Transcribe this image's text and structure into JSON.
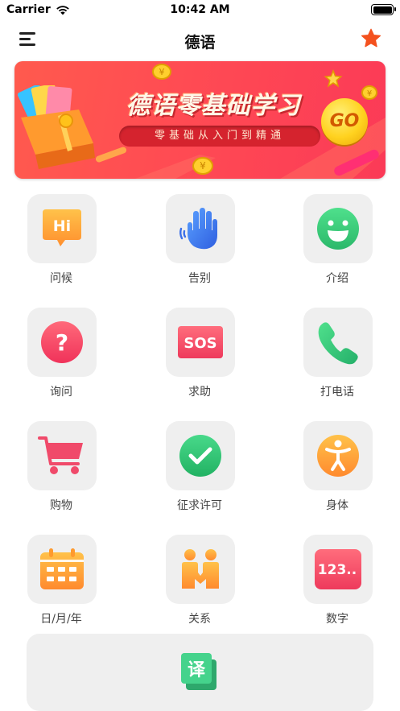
{
  "status_bar": {
    "carrier": "Carrier",
    "time": "10:42 AM",
    "wifi_icon": "wifi-icon",
    "battery_icon": "battery-icon"
  },
  "navbar": {
    "title": "德语",
    "menu_icon": "menu-icon",
    "favorite_icon": "star-icon",
    "accent": "#f4511e"
  },
  "banner": {
    "title": "德语零基础学习",
    "subtitle": "零基础从入门到精通",
    "badge": "GO",
    "background": "#ff4b53"
  },
  "categories": [
    {
      "label": "问候",
      "icon": "hi-bubble-icon"
    },
    {
      "label": "告别",
      "icon": "waving-hand-icon"
    },
    {
      "label": "介绍",
      "icon": "smiley-icon"
    },
    {
      "label": "询问",
      "icon": "question-icon"
    },
    {
      "label": "求助",
      "icon": "sos-icon"
    },
    {
      "label": "打电话",
      "icon": "phone-icon"
    },
    {
      "label": "购物",
      "icon": "shopping-cart-icon"
    },
    {
      "label": "征求许可",
      "icon": "check-icon"
    },
    {
      "label": "身体",
      "icon": "body-icon"
    },
    {
      "label": "日/月/年",
      "icon": "calendar-icon"
    },
    {
      "label": "关系",
      "icon": "relationship-icon"
    },
    {
      "label": "数字",
      "icon": "numbers-icon"
    }
  ],
  "translate": {
    "glyph": "译",
    "icon": "translate-icon",
    "color": "#3ec58a"
  }
}
